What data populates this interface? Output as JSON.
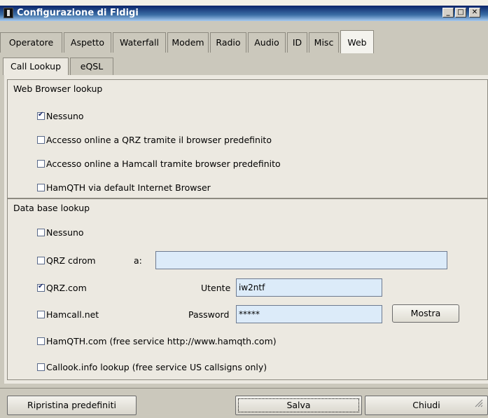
{
  "window": {
    "title": "Configurazione di Fldigi",
    "minimize_glyph": "_",
    "maximize_glyph": "□",
    "close_glyph": "✕"
  },
  "tabs": [
    {
      "label": "Operatore",
      "active": false
    },
    {
      "label": "Aspetto",
      "active": false
    },
    {
      "label": "Waterfall",
      "active": false
    },
    {
      "label": "Modem",
      "active": false
    },
    {
      "label": "Radio",
      "active": false
    },
    {
      "label": "Audio",
      "active": false
    },
    {
      "label": "ID",
      "active": false
    },
    {
      "label": "Misc",
      "active": false
    },
    {
      "label": "Web",
      "active": true
    }
  ],
  "subtabs": [
    {
      "label": "Call Lookup",
      "active": true
    },
    {
      "label": "eQSL",
      "active": false
    }
  ],
  "web_browser_lookup": {
    "title": "Web Browser lookup",
    "options": [
      {
        "label": "Nessuno",
        "checked": true
      },
      {
        "label": "Accesso online a QRZ tramite il browser predefinito",
        "checked": false
      },
      {
        "label": "Accesso online a Hamcall tramite browser predefinito",
        "checked": false
      },
      {
        "label": "HamQTH via default Internet Browser",
        "checked": false
      }
    ]
  },
  "database_lookup": {
    "title": "Data base lookup",
    "options": [
      {
        "label": "Nessuno",
        "checked": false
      },
      {
        "label": "QRZ cdrom",
        "checked": false
      },
      {
        "label": "QRZ.com",
        "checked": true
      },
      {
        "label": "Hamcall.net",
        "checked": false
      },
      {
        "label": "HamQTH.com (free service http://www.hamqth.com)",
        "checked": false
      },
      {
        "label": "Callook.info lookup (free service US callsigns only)",
        "checked": false
      }
    ],
    "cdrom_path_label": "a:",
    "cdrom_path_value": "",
    "user_label": "Utente",
    "user_value": "iw2ntf",
    "password_label": "Password",
    "password_value": "*****",
    "show_button": "Mostra"
  },
  "footer": {
    "restore_defaults": "Ripristina predefiniti",
    "save": "Salva",
    "close": "Chiudi"
  }
}
